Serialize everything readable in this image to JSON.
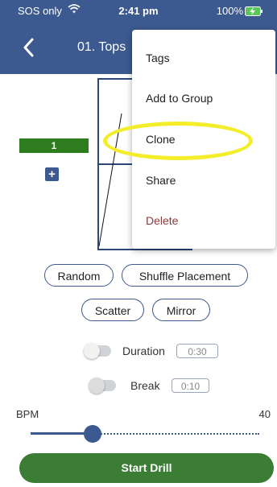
{
  "status_bar": {
    "carrier": "SOS only",
    "time": "2:41 pm",
    "battery": "100%",
    "wifi_icon": "wifi-icon",
    "battery_icon": "battery-charging-icon"
  },
  "nav": {
    "back_icon": "chevron-left-icon",
    "title": "01. Tops"
  },
  "drill": {
    "count": "1",
    "add_icon": "plus-icon"
  },
  "buttons": {
    "random": "Random",
    "shuffle": "Shuffle Placement",
    "scatter": "Scatter",
    "mirror": "Mirror"
  },
  "options": {
    "duration": {
      "label": "Duration",
      "value": "0:30",
      "enabled": false
    },
    "break": {
      "label": "Break",
      "value": "0:10",
      "enabled": false
    }
  },
  "bpm": {
    "label": "BPM",
    "value": "40",
    "level_fraction": 0.27
  },
  "start_label": "Start Drill",
  "menu": {
    "items": [
      "Tags",
      "Add to Group",
      "Clone",
      "Share",
      "Delete"
    ]
  },
  "colors": {
    "header": "#3c5a8f",
    "count_bar": "#2e7d1f",
    "start_button": "#3b7d35",
    "delete_text": "#8b3a3a",
    "highlight": "#f4ee2a"
  }
}
